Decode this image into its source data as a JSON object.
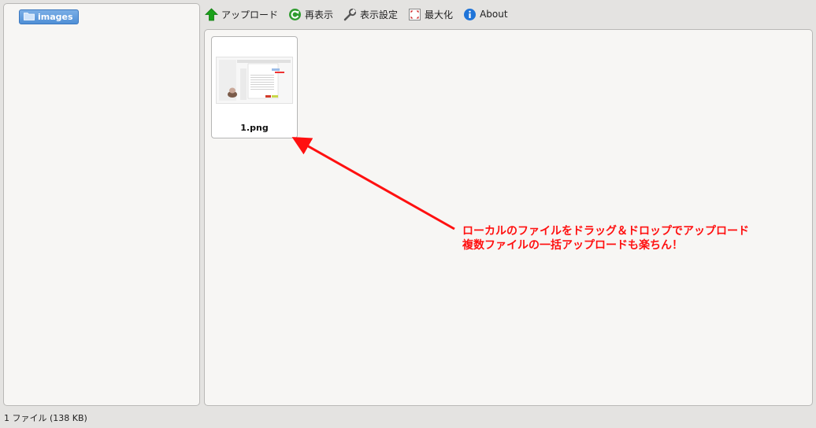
{
  "sidebar": {
    "folder": {
      "label": "images",
      "icon": "folder-icon"
    }
  },
  "toolbar": {
    "items": [
      {
        "label": "アップロード",
        "icon": "upload-arrow-icon",
        "color": "#1aa11a"
      },
      {
        "label": "再表示",
        "icon": "refresh-icon",
        "color": "#2f9c2f"
      },
      {
        "label": "表示設定",
        "icon": "wrench-icon",
        "color": "#555555"
      },
      {
        "label": "最大化",
        "icon": "maximize-icon",
        "color": "#cc2222"
      },
      {
        "label": "About",
        "icon": "info-icon",
        "color": "#1f74d8"
      }
    ]
  },
  "files": [
    {
      "name": "1.png",
      "thumbnail": "screenshot-thumbnail"
    }
  ],
  "annotation": {
    "line1": "ローカルのファイルをドラッグ＆ドロップでアップロード",
    "line2": "複数ファイルの一括アップロードも楽ちん！",
    "color": "#ff1010"
  },
  "status": {
    "text": "1 ファイル (138 KB)"
  },
  "colors": {
    "selection": "#5d9ce0",
    "panel_bg": "#f7f6f4",
    "window_bg": "#e4e3e1"
  }
}
